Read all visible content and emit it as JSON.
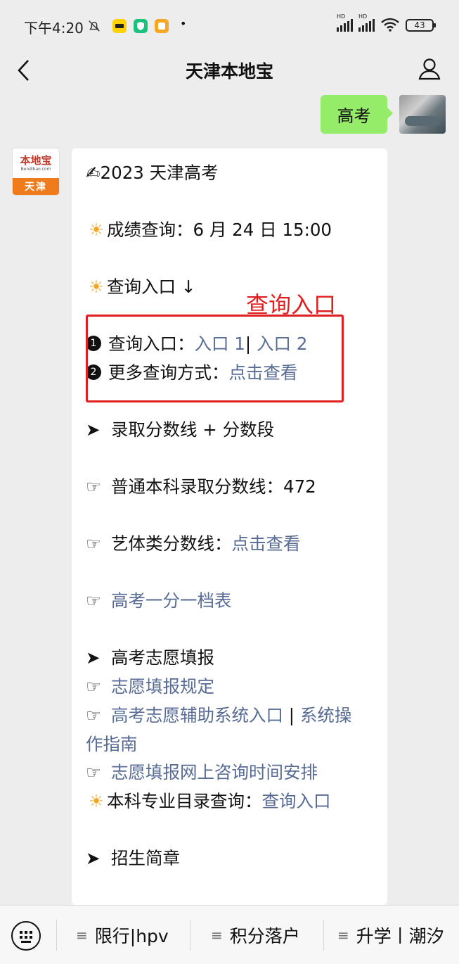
{
  "status_bar": {
    "time": "下午4:20",
    "app_icons": [
      "bell-off-icon",
      "meituan-icon",
      "shield-app-icon",
      "note-app-icon"
    ],
    "dot": "•",
    "net1": "HD",
    "net2": "HD",
    "battery": "43"
  },
  "header": {
    "title": "天津本地宝"
  },
  "user_message": {
    "text": "高考"
  },
  "bot_avatar": {
    "logo": "本地宝",
    "domain": "Bendibao.com",
    "city": "天津"
  },
  "bot_message": {
    "title_icon": "✍",
    "title": "2023 天津高考",
    "score_query": {
      "icon": "☀",
      "text": "成绩查询：6 月 24 日 15:00"
    },
    "entry_heading": {
      "icon": "☀",
      "text": "查询入口 ↓"
    },
    "entry_item1": {
      "num": "1",
      "label": "查询入口：",
      "link1": "入口 1",
      "sep": "|",
      "link2": "入口 2"
    },
    "entry_item2": {
      "num": "2",
      "label": "更多查询方式：",
      "link": "点击查看"
    },
    "score_line_heading": {
      "icon": "➤",
      "text": "录取分数线 + 分数段"
    },
    "undergrad_line": {
      "icon": "☞",
      "text": "普通本科录取分数线：472"
    },
    "art_line": {
      "icon": "☞",
      "label": "艺体类分数线：",
      "link": "点击查看"
    },
    "score_table": {
      "icon": "☞",
      "link": "高考一分一档表"
    },
    "volunteer_heading": {
      "icon": "➤",
      "text": "高考志愿填报"
    },
    "volunteer_rules": {
      "icon": "☞",
      "link": "志愿填报规定"
    },
    "volunteer_system": {
      "icon": "☞",
      "link1": "高考志愿辅助系统入口",
      "sep": "|",
      "link2_part1": "系统操",
      "link2_part2": "作指南"
    },
    "volunteer_consult": {
      "icon": "☞",
      "link": "志愿填报网上咨询时间安排"
    },
    "major_catalog": {
      "icon": "☀",
      "label": "本科专业目录查询：",
      "link": "查询入口"
    },
    "admission_guide": {
      "icon": "➤",
      "text": "招生简章"
    }
  },
  "annotation": {
    "label": "查询入口",
    "color": "#e02020"
  },
  "bottom_menu": {
    "items": [
      {
        "icon": "≡",
        "label": "限行|hpv"
      },
      {
        "icon": "≡",
        "label": "积分落户"
      },
      {
        "icon": "≡",
        "label": "升学丨潮汐"
      }
    ]
  },
  "colors": {
    "link": "#576b95",
    "user_bubble": "#95ec69",
    "background": "#ededed"
  }
}
